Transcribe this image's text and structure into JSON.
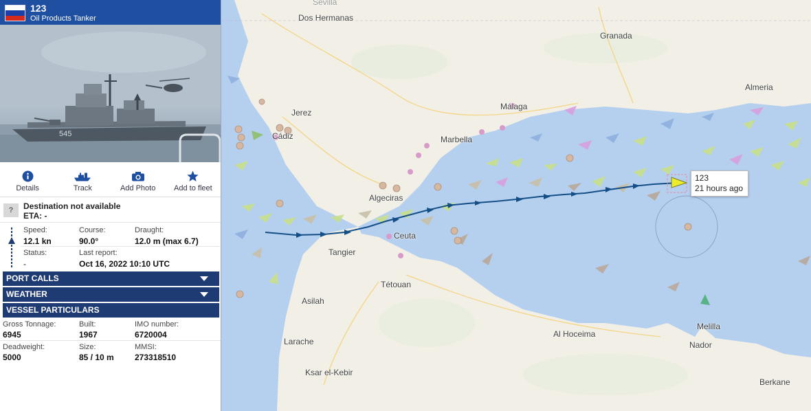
{
  "vessel": {
    "name": "123",
    "type": "Oil Products Tanker",
    "flag_colors": [
      "#ffffff",
      "#1c3fa8",
      "#d52b1e"
    ],
    "photo_hull_number": "545"
  },
  "actions": [
    {
      "label": "Details",
      "icon": "info-icon"
    },
    {
      "label": "Track",
      "icon": "ship-icon"
    },
    {
      "label": "Add Photo",
      "icon": "camera-icon"
    },
    {
      "label": "Add to fleet",
      "icon": "star-icon"
    }
  ],
  "destination": {
    "icon_text": "?",
    "title": "Destination not available",
    "eta": "ETA: -"
  },
  "voyage": {
    "speed_label": "Speed:",
    "speed": "12.1 kn",
    "course_label": "Course:",
    "course": "90.0°",
    "draught_label": "Draught:",
    "draught": "12.0 m (max 6.7)",
    "status_label": "Status:",
    "status": "-",
    "report_label": "Last report:",
    "report": "Oct 16, 2022 10:10 UTC"
  },
  "sections": {
    "port_calls": "PORT CALLS",
    "weather": "WEATHER",
    "particulars": "VESSEL PARTICULARS"
  },
  "particulars": {
    "gross_tonnage_label": "Gross Tonnage:",
    "gross_tonnage": "6945",
    "built_label": "Built:",
    "built": "1967",
    "imo_label": "IMO number:",
    "imo": "6720004",
    "deadweight_label": "Deadweight:",
    "deadweight": "5000",
    "size_label": "Size:",
    "size": "85 / 10 m",
    "mmsi_label": "MMSI:",
    "mmsi": "273318510"
  },
  "map": {
    "places": {
      "sevilla": "Sevilla",
      "dos_hermanas": "Dos Hermanas",
      "granada": "Granada",
      "almeria": "Almeria",
      "jerez": "Jerez",
      "malaga": "Málaga",
      "cadiz": "Cádiz",
      "marbella": "Marbella",
      "algeciras": "Algeciras",
      "ceuta": "Ceuta",
      "tangier": "Tangier",
      "tetouan": "Tétouan",
      "asilah": "Asilah",
      "al_hoceima": "Al Hoceima",
      "melilla": "Melilla",
      "nador": "Nador",
      "larache": "Larache",
      "ksar": "Ksar el-Kebir",
      "berkane": "Berkane"
    },
    "tooltip": {
      "name": "123",
      "time_ago": "21 hours ago"
    },
    "colors": {
      "sea": "#b5d0ef",
      "land": "#f1efe6",
      "track": "#134e86",
      "selected_vessel": "#ecec2f"
    }
  }
}
